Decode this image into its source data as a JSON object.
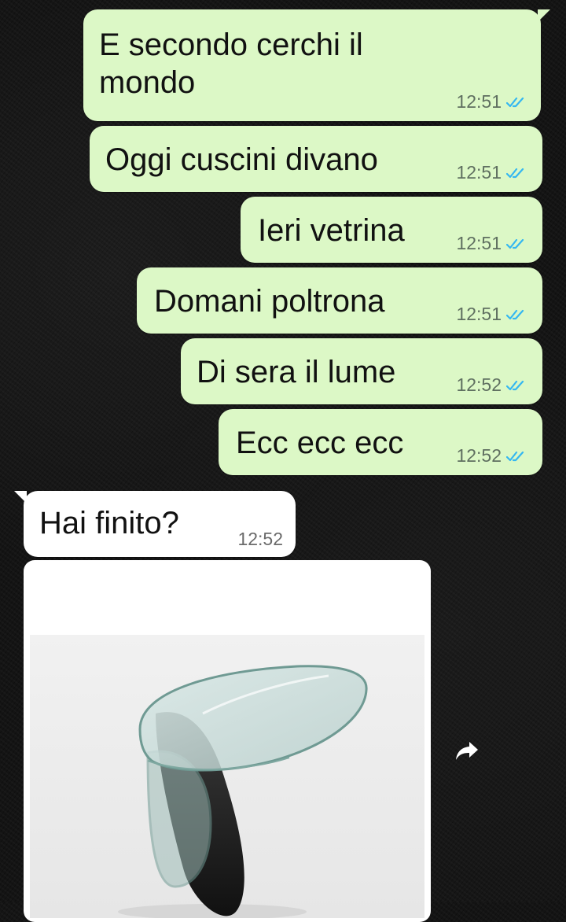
{
  "messages_outgoing": [
    {
      "text_line1": "E secondo cerchi il",
      "text_line2": "mondo",
      "time": "12:51"
    },
    {
      "text": "Oggi cuscini divano",
      "time": "12:51"
    },
    {
      "text": "Ieri vetrina",
      "time": "12:51"
    },
    {
      "text": "Domani poltrona",
      "time": "12:51"
    },
    {
      "text": "Di sera il lume",
      "time": "12:52"
    },
    {
      "text": "Ecc ecc ecc",
      "time": "12:52"
    }
  ],
  "message_incoming": {
    "text": "Hai finito?",
    "time": "12:52"
  },
  "image_message": {
    "subject": "glass coffee table photo"
  },
  "icons": {
    "read_receipt": "double-check-icon",
    "forward": "forward-arrow-icon"
  },
  "colors": {
    "outgoing_bubble": "#dcf8c6",
    "incoming_bubble": "#ffffff",
    "read_tick": "#34b7f1"
  }
}
